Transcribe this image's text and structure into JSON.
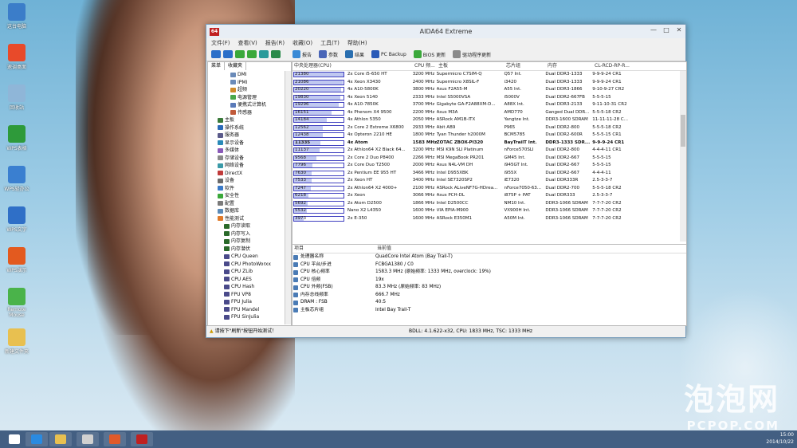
{
  "desktop_icons": [
    {
      "label": "这台电脑",
      "icon": "computer-icon",
      "color": "#3b7dc9"
    },
    {
      "label": "速调桌面",
      "icon": "desktop-tool-icon",
      "color": "#e84a2a"
    },
    {
      "label": "回收站",
      "icon": "recycle-bin-icon",
      "color": "#8fb6d8"
    },
    {
      "label": "WPS表格",
      "icon": "wps-spreadsheet-icon",
      "color": "#2e9a3a"
    },
    {
      "label": "WPS轻办公",
      "icon": "wps-office-icon",
      "color": "#3a7fd0"
    },
    {
      "label": "WPS文字",
      "icon": "wps-writer-icon",
      "color": "#2f6fc7"
    },
    {
      "label": "WPS演示",
      "icon": "wps-presentation-icon",
      "color": "#e35a1f"
    },
    {
      "label": "Remote Mouse",
      "icon": "remote-mouse-icon",
      "color": "#4ab34a"
    },
    {
      "label": "新建文件夹",
      "icon": "folder-icon",
      "color": "#e8c050"
    }
  ],
  "window": {
    "title": "AIDA64 Extreme",
    "app_badge": "64",
    "controls": [
      "—",
      "□",
      "✕"
    ],
    "menu": [
      "文件(F)",
      "查看(V)",
      "报告(R)",
      "收藏(O)",
      "工具(T)",
      "帮助(H)"
    ],
    "toolbar": [
      {
        "label": "报告",
        "icon": "report-icon",
        "color": "#3a8ad6"
      },
      {
        "label": "参数",
        "icon": "parameters-icon",
        "color": "#4a66b8"
      },
      {
        "label": "结果",
        "icon": "results-icon",
        "color": "#2a6fb0"
      },
      {
        "label": "PC Backup",
        "icon": "pc-backup-icon",
        "color": "#2a5ab8"
      },
      {
        "label": "BIOS 更新",
        "icon": "bios-update-icon",
        "color": "#3aa83a"
      },
      {
        "label": "驱动程序更新",
        "icon": "driver-update-icon",
        "color": "#8a8a8a"
      }
    ],
    "nav_icons": [
      {
        "name": "back-icon",
        "color": "#2c6fc9"
      },
      {
        "name": "forward-icon",
        "color": "#2c6fc9"
      },
      {
        "name": "up-icon",
        "color": "#3aa83a"
      },
      {
        "name": "refresh-icon",
        "color": "#3aa83a"
      },
      {
        "name": "report-favorite-icon",
        "color": "#2a9a9a"
      },
      {
        "name": "chart-icon",
        "color": "#2a8a4a"
      }
    ],
    "left_tabs": [
      "菜单",
      "收藏夹"
    ],
    "tree": [
      {
        "label": "DMI",
        "indent": 3,
        "color": "#6a8ab8"
      },
      {
        "label": "IPMI",
        "indent": 3,
        "color": "#6a8ab8"
      },
      {
        "label": "超频",
        "indent": 3,
        "color": "#d08a2a"
      },
      {
        "label": "电源管理",
        "indent": 3,
        "color": "#4aa84a"
      },
      {
        "label": "便携式计算机",
        "indent": 3,
        "color": "#5a7ab8"
      },
      {
        "label": "传感器",
        "indent": 3,
        "color": "#c05a3a"
      },
      {
        "label": "主板",
        "indent": 1,
        "color": "#3a7a3a"
      },
      {
        "label": "操作系统",
        "indent": 1,
        "color": "#2a6ab8"
      },
      {
        "label": "服务器",
        "indent": 1,
        "color": "#5a5a8a"
      },
      {
        "label": "显示设备",
        "indent": 1,
        "color": "#2a8ab8"
      },
      {
        "label": "多媒体",
        "indent": 1,
        "color": "#8a5ab8"
      },
      {
        "label": "存储设备",
        "indent": 1,
        "color": "#8a8a8a"
      },
      {
        "label": "网络设备",
        "indent": 1,
        "color": "#3a9aa8"
      },
      {
        "label": "DirectX",
        "indent": 1,
        "color": "#c03a3a"
      },
      {
        "label": "设备",
        "indent": 1,
        "color": "#6a6a6a"
      },
      {
        "label": "软件",
        "indent": 1,
        "color": "#3a7ac8"
      },
      {
        "label": "安全性",
        "indent": 1,
        "color": "#3aa83a"
      },
      {
        "label": "配置",
        "indent": 1,
        "color": "#7a7a7a"
      },
      {
        "label": "数据库",
        "indent": 1,
        "color": "#5a8ab8"
      },
      {
        "label": "性能测试",
        "indent": 1,
        "color": "#e07a2a"
      },
      {
        "label": "内存读取",
        "indent": 2,
        "color": "#2a6a2a"
      },
      {
        "label": "内存写入",
        "indent": 2,
        "color": "#2a6a2a"
      },
      {
        "label": "内存复制",
        "indent": 2,
        "color": "#2a6a2a"
      },
      {
        "label": "内存潜伏",
        "indent": 2,
        "color": "#2a6a2a"
      },
      {
        "label": "CPU Queen",
        "indent": 2,
        "color": "#4a4a8a"
      },
      {
        "label": "CPU PhotoWorxx",
        "indent": 2,
        "color": "#4a4a8a"
      },
      {
        "label": "CPU ZLib",
        "indent": 2,
        "color": "#4a4a8a"
      },
      {
        "label": "CPU AES",
        "indent": 2,
        "color": "#4a4a8a"
      },
      {
        "label": "CPU Hash",
        "indent": 2,
        "color": "#4a4a8a"
      },
      {
        "label": "FPU VP8",
        "indent": 2,
        "color": "#4a4a8a"
      },
      {
        "label": "FPU Julia",
        "indent": 2,
        "color": "#4a4a8a"
      },
      {
        "label": "FPU Mandel",
        "indent": 2,
        "color": "#4a4a8a"
      },
      {
        "label": "FPU SinJulia",
        "indent": 2,
        "color": "#4a4a8a"
      }
    ],
    "grid_headers": [
      "中央处理器(CPU)",
      "CPU 频...",
      "主板",
      "芯片组",
      "内存",
      "CL-RCD-RP-R..."
    ],
    "grid_rows": [
      {
        "score": "21380",
        "cpu": "2x Core i5-650 HT",
        "freq": "3200 MHz",
        "board": "Supermicro C7SIM-Q",
        "chipset": "Q57 Int.",
        "mem": "Dual DDR3-1333",
        "timing": "9-9-9-24 CR1"
      },
      {
        "score": "21086",
        "cpu": "4x Xeon X3430",
        "freq": "2400 MHz",
        "board": "Supermicro X8SIL-F",
        "chipset": "i3420",
        "mem": "Dual DDR3-1333",
        "timing": "9-9-9-24 CR1"
      },
      {
        "score": "20220",
        "cpu": "4x A10-5800K",
        "freq": "3800 MHz",
        "board": "Asus F2A55-M",
        "chipset": "A55 Int.",
        "mem": "Dual DDR3-1866",
        "timing": "9-10-9-27 CR2"
      },
      {
        "score": "19830",
        "cpu": "4x Xeon 5140",
        "freq": "2333 MHz",
        "board": "Intel S5000VSA",
        "chipset": "i5000V",
        "mem": "Dual DDR2-667FB",
        "timing": "5-5-5-15"
      },
      {
        "score": "19296",
        "cpu": "4x A10-7850K",
        "freq": "3700 MHz",
        "board": "Gigabyte GA-F2A88XM-D...",
        "chipset": "A88X Int.",
        "mem": "Dual DDR3-2133",
        "timing": "9-11-10-31 CR2"
      },
      {
        "score": "16151",
        "cpu": "4x Phenom X4 9500",
        "freq": "2200 MHz",
        "board": "Asus M3A",
        "chipset": "AMD770",
        "mem": "Ganged Dual DDR...",
        "timing": "5-5-5-18 CR2"
      },
      {
        "score": "14184",
        "cpu": "4x Athlon 5350",
        "freq": "2050 MHz",
        "board": "ASRock AM1B-ITX",
        "chipset": "Yangtze Int.",
        "mem": "DDR3-1600 SDRAM",
        "timing": "11-11-11-28 C..."
      },
      {
        "score": "12562",
        "cpu": "2x Core 2 Extreme X6800",
        "freq": "2933 MHz",
        "board": "Abit AB9",
        "chipset": "P965",
        "mem": "Dual DDR2-800",
        "timing": "5-5-5-18 CR2"
      },
      {
        "score": "12438",
        "cpu": "4x Opteron 2210 HE",
        "freq": "1800 MHz",
        "board": "Tyan Thunder h2000M",
        "chipset": "BCM5785",
        "mem": "Dual DDR2-600R",
        "timing": "5-5-5-15 CR1"
      },
      {
        "score": "11335",
        "cpu": "4x Atom",
        "freq": "1583 MHz",
        "board": "ZOTAC ZBOX-PI320",
        "chipset": "BayTrailT Int.",
        "mem": "DDR3-1333 SDR...",
        "timing": "9-9-9-24 CR1",
        "highlight": true
      },
      {
        "score": "11137",
        "cpu": "2x Athlon64 X2 Black 64...",
        "freq": "3200 MHz",
        "board": "MSI K9N SLI Platinum",
        "chipset": "nForce570SLI",
        "mem": "Dual DDR2-800",
        "timing": "4-4-4-11 CR1"
      },
      {
        "score": "9568",
        "cpu": "2x Core 2 Duo P8400",
        "freq": "2266 MHz",
        "board": "MSI MegaBook PR201",
        "chipset": "GM45 Int.",
        "mem": "Dual DDR2-667",
        "timing": "5-5-5-15"
      },
      {
        "score": "7796",
        "cpu": "2x Core Duo T2500",
        "freq": "2000 MHz",
        "board": "Asus N4L-VM DH",
        "chipset": "i945GT Int.",
        "mem": "Dual DDR2-667",
        "timing": "5-5-5-15"
      },
      {
        "score": "7630",
        "cpu": "2x Pentium EE 955 HT",
        "freq": "3466 MHz",
        "board": "Intel D955XBK",
        "chipset": "i955X",
        "mem": "Dual DDR2-667",
        "timing": "4-4-4-11"
      },
      {
        "score": "7533",
        "cpu": "2x Xeon HT",
        "freq": "3400 MHz",
        "board": "Intel SE7320SP2",
        "chipset": "iE7320",
        "mem": "Dual DDR333R",
        "timing": "2.5-3-3-7"
      },
      {
        "score": "7247",
        "cpu": "2x Athlon64 X2 4000+",
        "freq": "2100 MHz",
        "board": "ASRock ALiveNF7G-HDrea...",
        "chipset": "nForce7050-63...",
        "mem": "Dual DDR2-700",
        "timing": "5-5-5-18 CR2"
      },
      {
        "score": "6218",
        "cpu": "2x Xeon",
        "freq": "3066 MHz",
        "board": "Asus PCH-DL",
        "chipset": "i875P + PAT",
        "mem": "Dual DDR333",
        "timing": "2.5-3-3-7"
      },
      {
        "score": "5692",
        "cpu": "2x Atom D2500",
        "freq": "1866 MHz",
        "board": "Intel D2500CC",
        "chipset": "NM10 Int.",
        "mem": "DDR3-1066 SDRAM",
        "timing": "7-7-7-20 CR2"
      },
      {
        "score": "5532",
        "cpu": "Nano X2 L4350",
        "freq": "1600 MHz",
        "board": "VIA EPIA-M900",
        "chipset": "VX900H Int.",
        "mem": "DDR3-1066 SDRAM",
        "timing": "7-7-7-20 CR2"
      },
      {
        "score": "3973",
        "cpu": "2x E-350",
        "freq": "1600 MHz",
        "board": "ASRock E350M1",
        "chipset": "A50M Int.",
        "mem": "DDR3-1066 SDRAM",
        "timing": "7-7-7-20 CR2"
      }
    ],
    "score_max": 21380,
    "detail_headers": [
      "项目",
      "当前值"
    ],
    "details": [
      {
        "key": "处理器名称",
        "value": "QuadCore Intel Atom (Bay Trail-T)"
      },
      {
        "key": "CPU 平台/步进",
        "value": "FCBGA1380 / C0"
      },
      {
        "key": "CPU 核心频率",
        "value": "1583.3 MHz (原始频率: 1333 MHz, overclock: 19%)"
      },
      {
        "key": "CPU 倍频",
        "value": "19x"
      },
      {
        "key": "CPU 外频(FSB)",
        "value": "83.3 MHz (原始频率: 83 MHz)"
      },
      {
        "key": "内存总线频率",
        "value": "666.7 MHz"
      },
      {
        "key": "DRAM : FSB",
        "value": "40:5"
      },
      {
        "key": "主板芯片组",
        "value": "Intel Bay Trail-T"
      }
    ],
    "status_left": "请按下\"刷新\"按钮开始测试！",
    "status_right": "BDLL: 4.1.622-x32, CPU: 1833 MHz, TSC: 1333 MHz"
  },
  "taskbar": {
    "apps": [
      {
        "name": "start-icon",
        "color": "#ffffff"
      },
      {
        "name": "ie-icon",
        "color": "#2a8ae0"
      },
      {
        "name": "file-explorer-icon",
        "color": "#e8c050"
      },
      {
        "name": "media-icon",
        "color": "#d0d0d0"
      },
      {
        "name": "color-app-icon",
        "color": "#e05a2a"
      },
      {
        "name": "aida64-icon",
        "color": "#c02020"
      }
    ],
    "time": "15:00",
    "date": "2014/10/22"
  },
  "watermark": {
    "cn": "泡泡网",
    "en": "PCPOP.COM"
  }
}
